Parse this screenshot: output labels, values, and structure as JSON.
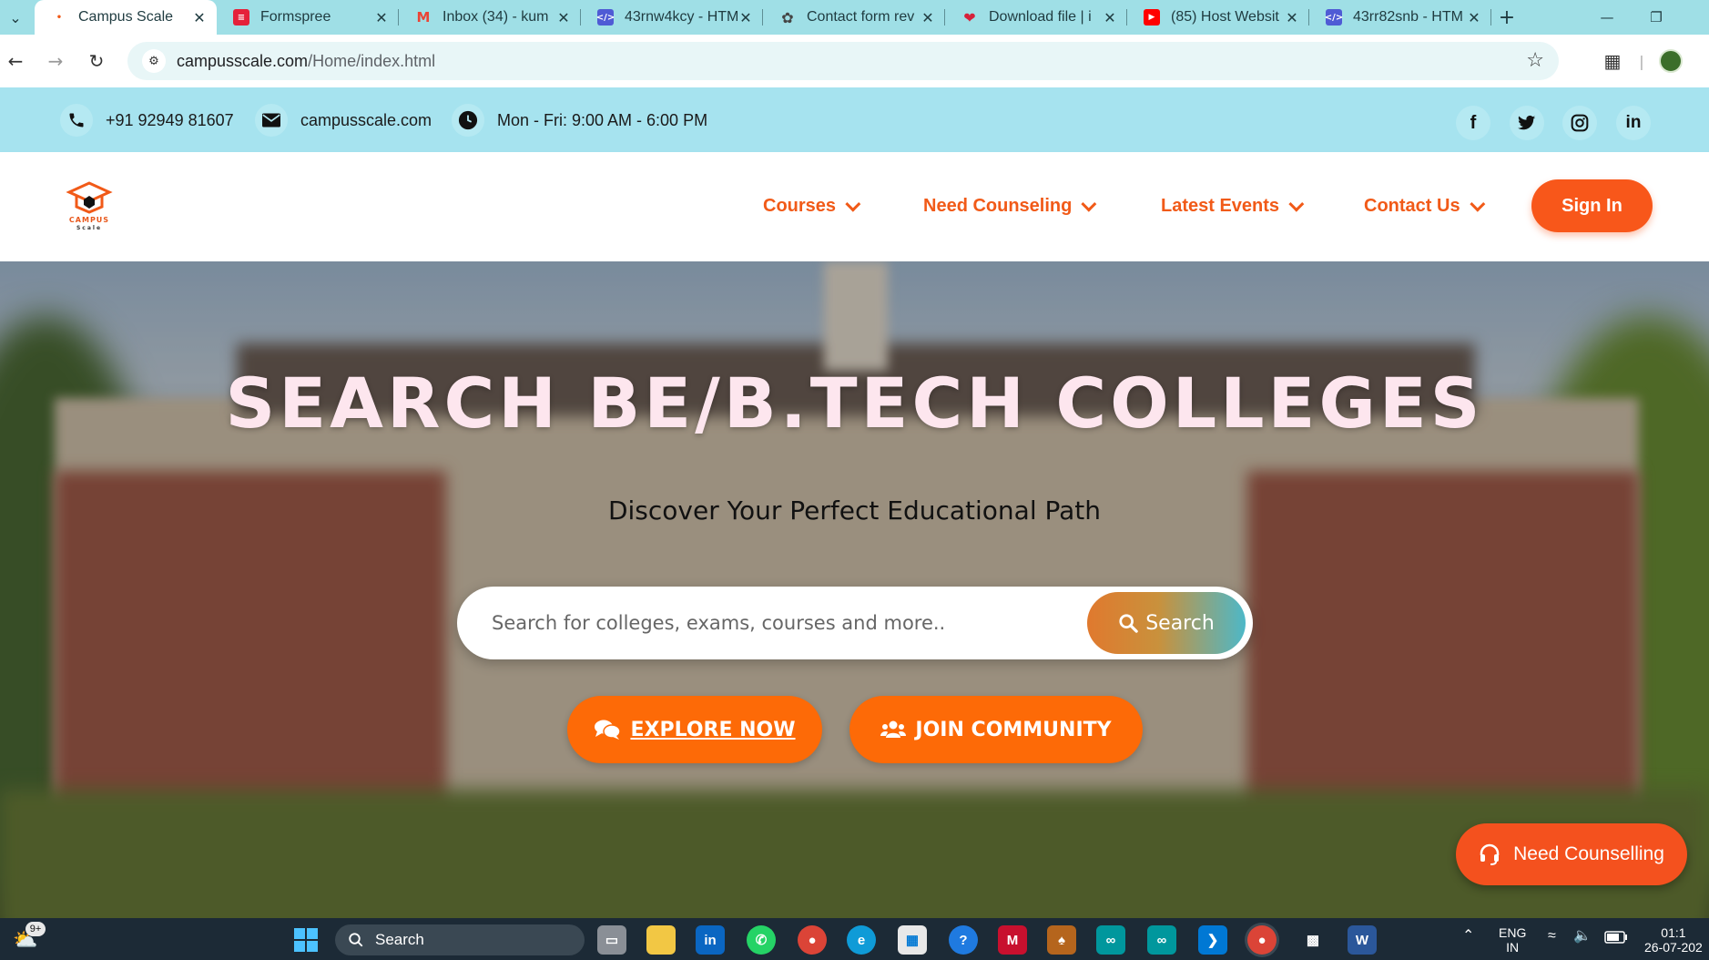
{
  "browser": {
    "tabs": [
      {
        "title": "Campus Scale",
        "favicon": "campus-scale",
        "color": "#f15a18",
        "active": true
      },
      {
        "title": "Formspree",
        "favicon": "formspree",
        "color": "#e5213a",
        "active": false
      },
      {
        "title": "Inbox (34) - kum",
        "favicon": "gmail",
        "color": "#ea4335",
        "active": false
      },
      {
        "title": "43rnw4kcy - HTM",
        "favicon": "code",
        "color": "#4f5bd5",
        "active": false
      },
      {
        "title": "Contact form rev",
        "favicon": "openai",
        "color": "#444444",
        "active": false
      },
      {
        "title": "Download file | i",
        "favicon": "heart",
        "color": "#d6213a",
        "active": false
      },
      {
        "title": "(85) Host Websit",
        "favicon": "youtube",
        "color": "#ff0000",
        "active": false
      },
      {
        "title": "43rr82snb - HTM",
        "favicon": "code",
        "color": "#4f5bd5",
        "active": false
      }
    ],
    "new_tab": "+",
    "url_domain": "campusscale.com",
    "url_path": "/Home/index.html"
  },
  "topbar": {
    "phone": "+91 92949 81607",
    "email": "campusscale.com",
    "hours": "Mon - Fri: 9:00 AM - 6:00 PM",
    "social": [
      "facebook",
      "twitter",
      "instagram",
      "linkedin"
    ]
  },
  "nav": {
    "logo_line1": "CAMPUS",
    "logo_line2": "Scale",
    "items": [
      "Courses",
      "Need Counseling",
      "Latest Events",
      "Contact Us"
    ],
    "signin": "Sign In"
  },
  "hero": {
    "title": "SEARCH BE/B.TECH COLLEGES",
    "subtitle": "Discover Your Perfect Educational Path",
    "search_placeholder": "Search for colleges, exams, courses and more..",
    "search_button": "Search",
    "explore": "EXPLORE NOW",
    "join": "JOIN COMMUNITY"
  },
  "floating": {
    "label": "Need Counselling"
  },
  "taskbar": {
    "search": "Search",
    "badge": "9+",
    "lang1": "ENG",
    "lang2": "IN",
    "time": "01:1",
    "date": "26-07-202"
  },
  "colors": {
    "accent": "#f8571a",
    "topbar": "#a6e3ef",
    "cta": "#fd6a07"
  }
}
